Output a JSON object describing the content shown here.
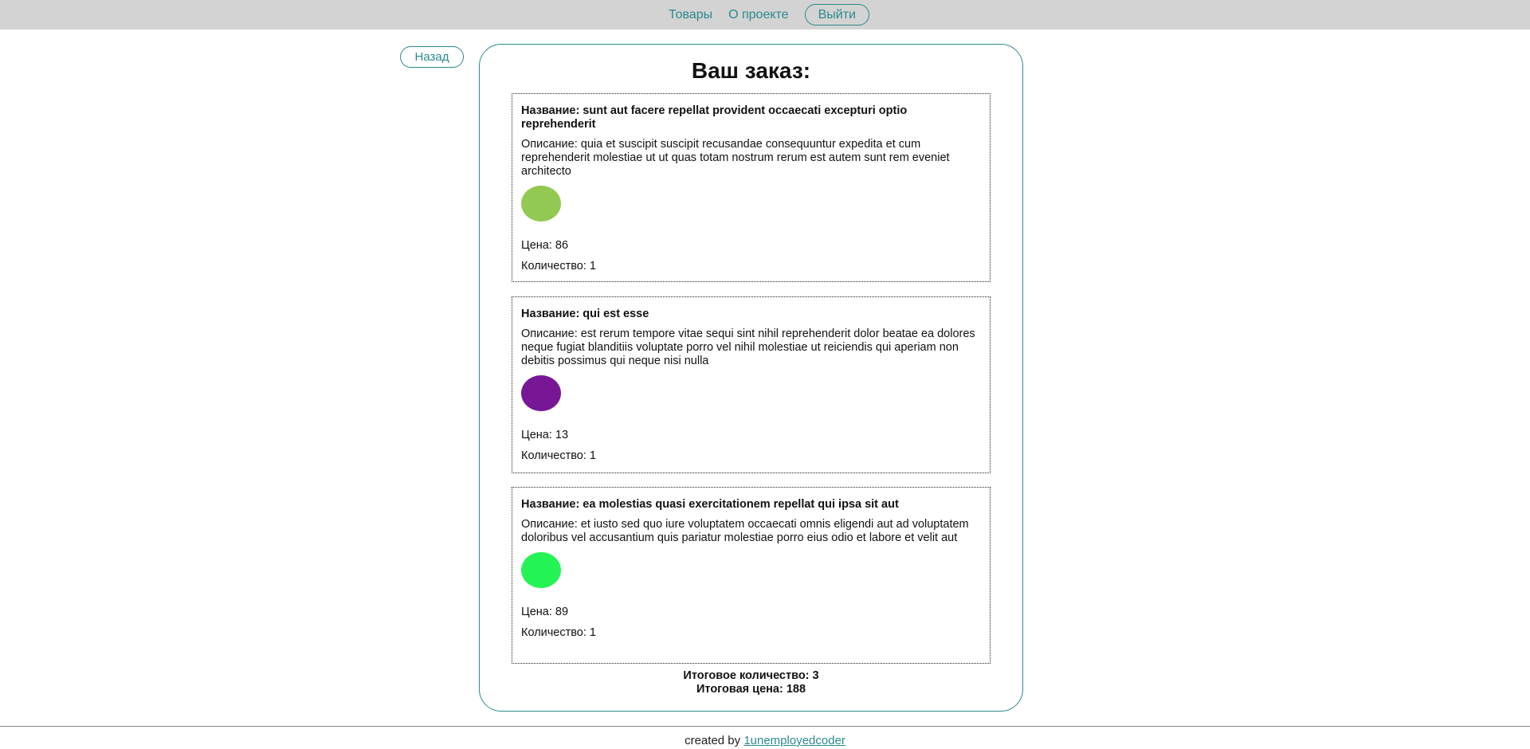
{
  "nav": {
    "products": "Товары",
    "about": "О проекте",
    "logout": "Выйти"
  },
  "back_label": "Назад",
  "order": {
    "title": "Ваш заказ:",
    "items": [
      {
        "name": "Название: sunt aut facere repellat provident occaecati excepturi optio reprehenderit",
        "description": "Описание: quia et suscipit suscipit recusandae consequuntur expedita et cum reprehenderit molestiae ut ut quas totam nostrum rerum est autem sunt rem eveniet architecto",
        "color": "#92c952",
        "price": "Цена: 86",
        "quantity": "Количество: 1"
      },
      {
        "name": "Название: qui est esse",
        "description": "Описание: est rerum tempore vitae sequi sint nihil reprehenderit dolor beatae ea dolores neque fugiat blanditiis voluptate porro vel nihil molestiae ut reiciendis qui aperiam non debitis possimus qui neque nisi nulla",
        "color": "#771796",
        "price": "Цена: 13",
        "quantity": "Количество: 1"
      },
      {
        "name": "Название: ea molestias quasi exercitationem repellat qui ipsa sit aut",
        "description": "Описание: et iusto sed quo iure voluptatem occaecati omnis eligendi aut ad voluptatem doloribus vel accusantium quis pariatur molestiae porro eius odio et labore et velit aut",
        "color": "#24f355",
        "price": "Цена: 89",
        "quantity": "Количество: 1"
      }
    ],
    "total_quantity": "Итоговое количество: 3",
    "total_price": "Итоговая цена: 188"
  },
  "footer": {
    "prefix": "created by",
    "author": "1unemployedcoder"
  }
}
